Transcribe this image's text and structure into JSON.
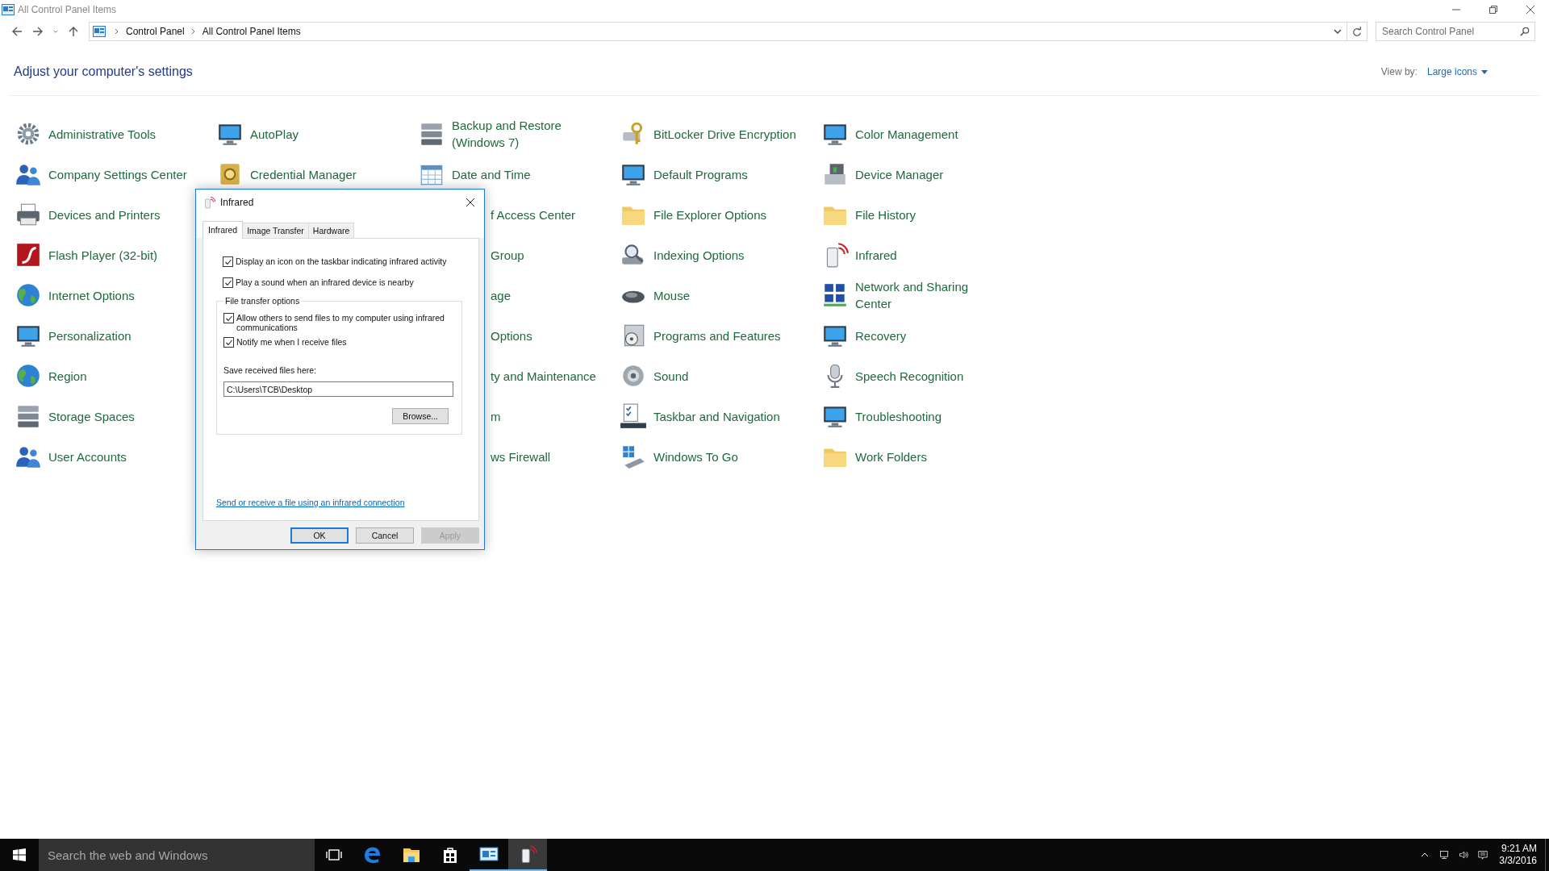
{
  "window": {
    "title": "All Control Panel Items"
  },
  "address": {
    "crumbs": [
      "Control Panel",
      "All Control Panel Items"
    ]
  },
  "search": {
    "placeholder": "Search Control Panel"
  },
  "heading": "Adjust your computer's settings",
  "view_by": {
    "label": "View by:",
    "value": "Large icons"
  },
  "columns": [
    [
      {
        "label": "Administrative Tools",
        "covered": false
      },
      {
        "label": "Company Settings Center",
        "covered": false
      },
      {
        "label": "Devices and Printers",
        "covered": false
      },
      {
        "label": "Flash Player (32-bit)",
        "covered": false
      },
      {
        "label": "Internet Options",
        "covered": false
      },
      {
        "label": "Personalization",
        "covered": false
      },
      {
        "label": "Region",
        "covered": false
      },
      {
        "label": "Storage Spaces",
        "covered": false
      },
      {
        "label": "User Accounts",
        "covered": false
      }
    ],
    [
      {
        "label": "AutoPlay",
        "covered": false
      },
      {
        "label": "Credential Manager",
        "covered": false
      }
    ],
    [
      {
        "label": "Backup and Restore (Windows 7)",
        "covered": false
      },
      {
        "label": "Date and Time",
        "covered": false
      },
      {
        "label": "f Access Center",
        "covered": true
      },
      {
        "label": "Group",
        "covered": true
      },
      {
        "label": "age",
        "covered": true
      },
      {
        "label": "Options",
        "covered": true
      },
      {
        "label": "ty and Maintenance",
        "covered": true
      },
      {
        "label": "m",
        "covered": true
      },
      {
        "label": "ws Firewall",
        "covered": true
      }
    ],
    [
      {
        "label": "BitLocker Drive Encryption",
        "covered": false
      },
      {
        "label": "Default Programs",
        "covered": false
      },
      {
        "label": "File Explorer Options",
        "covered": false
      },
      {
        "label": "Indexing Options",
        "covered": false
      },
      {
        "label": "Mouse",
        "covered": false
      },
      {
        "label": "Programs and Features",
        "covered": false
      },
      {
        "label": "Sound",
        "covered": false
      },
      {
        "label": "Taskbar and Navigation",
        "covered": false
      },
      {
        "label": "Windows To Go",
        "covered": false
      }
    ],
    [
      {
        "label": "Color Management",
        "covered": false
      },
      {
        "label": "Device Manager",
        "covered": false
      },
      {
        "label": "File History",
        "covered": false
      },
      {
        "label": "Infrared",
        "covered": false
      },
      {
        "label": "Network and Sharing Center",
        "covered": false
      },
      {
        "label": "Recovery",
        "covered": false
      },
      {
        "label": "Speech Recognition",
        "covered": false
      },
      {
        "label": "Troubleshooting",
        "covered": false
      },
      {
        "label": "Work Folders",
        "covered": false
      }
    ]
  ],
  "dialog": {
    "title": "Infrared",
    "tabs": [
      {
        "label": "Infrared",
        "selected": true
      },
      {
        "label": "Image Transfer",
        "selected": false
      },
      {
        "label": "Hardware",
        "selected": false
      }
    ],
    "options": [
      {
        "label": "Display an icon on the taskbar indicating infrared activity",
        "checked": true
      },
      {
        "label": "Play a sound when an infrared device is nearby",
        "checked": true
      }
    ],
    "group": {
      "title": "File transfer options",
      "options": [
        {
          "label": "Allow others to send files to my computer using infrared communications",
          "checked": true
        },
        {
          "label": "Notify me when I receive files",
          "checked": true
        }
      ],
      "save_label": "Save received files here:",
      "save_path": "C:\\Users\\TCB\\Desktop",
      "browse": "Browse..."
    },
    "link": "Send or receive a file using an infrared connection",
    "buttons": [
      {
        "label": "OK",
        "default": true,
        "disabled": false
      },
      {
        "label": "Cancel",
        "default": false,
        "disabled": false
      },
      {
        "label": "Apply",
        "default": false,
        "disabled": true
      }
    ]
  },
  "taskbar": {
    "search_placeholder": "Search the web and Windows",
    "apps": [
      {
        "running": false,
        "selected": false
      },
      {
        "running": false,
        "selected": false
      },
      {
        "running": false,
        "selected": false
      },
      {
        "running": true,
        "selected": false
      },
      {
        "running": true,
        "selected": true
      }
    ],
    "time": "9:21 AM",
    "date": "3/3/2016"
  }
}
